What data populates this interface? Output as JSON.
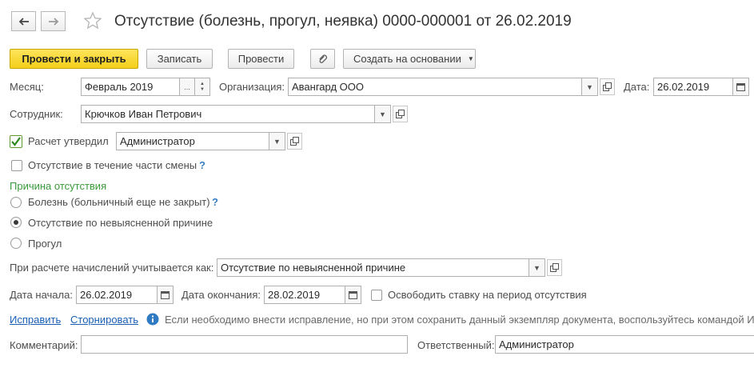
{
  "title": "Отсутствие (болезнь, прогул, неявка) 0000-000001 от 26.02.2019",
  "nav": {
    "back": "←",
    "forward": "→",
    "star": "☆"
  },
  "toolbar": {
    "post_close": "Провести и закрыть",
    "save": "Записать",
    "post": "Провести",
    "create_based": "Создать на основании"
  },
  "form": {
    "month_label": "Месяц:",
    "month_value": "Февраль 2019",
    "org_label": "Организация:",
    "org_value": "Авангард ООО",
    "date_label": "Дата:",
    "date_value": "26.02.2019",
    "employee_label": "Сотрудник:",
    "employee_value": "Крючков Иван Петрович",
    "approved_label": "Расчет утвердил",
    "approved_checked": true,
    "approved_value": "Администратор",
    "partial_shift_label": "Отсутствие в течение части смены",
    "reason_header": "Причина отсутствия",
    "reasons": [
      {
        "label": "Болезнь (больничный еще не закрыт)",
        "selected": false,
        "help": true
      },
      {
        "label": "Отсутствие по невыясненной причине",
        "selected": true,
        "help": false
      },
      {
        "label": "Прогул",
        "selected": false,
        "help": false
      }
    ],
    "accrual_label": "При расчете начислений учитывается как:",
    "accrual_value": "Отсутствие по невыясненной причине",
    "start_label": "Дата начала:",
    "start_value": "26.02.2019",
    "end_label": "Дата окончания:",
    "end_value": "28.02.2019",
    "free_rate_label": "Освободить ставку на период отсутствия",
    "fix_link": "Исправить",
    "storno_link": "Сторнировать",
    "info_text": "Если необходимо внести исправление, но при этом сохранить данный экземпляр документа, воспользуйтесь командой И",
    "comment_label": "Комментарий:",
    "comment_value": "",
    "responsible_label": "Ответственный:",
    "responsible_value": "Администратор",
    "help_mark": "?"
  },
  "colors": {
    "primary_button": "#f5cf19",
    "section_header": "#3a9a3a",
    "link": "#1a5fb4",
    "info_icon": "#2e7bc4"
  }
}
